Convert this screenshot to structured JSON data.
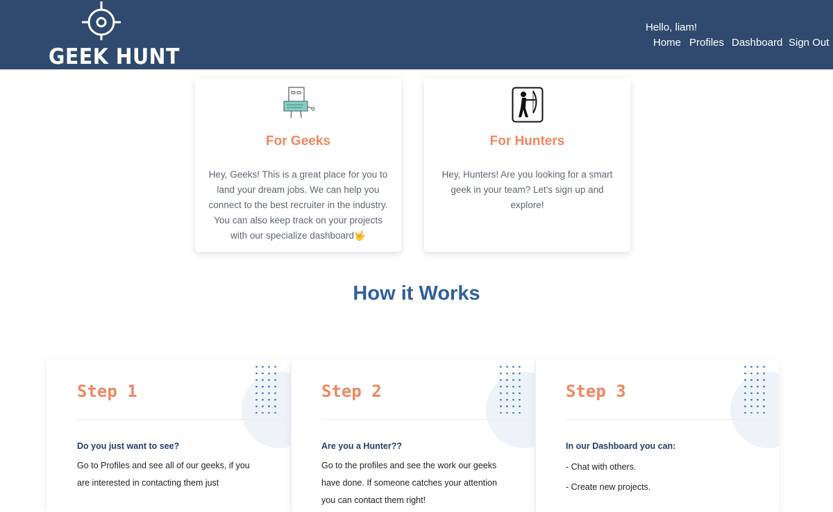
{
  "header": {
    "logo_text": "GEEK HUNT",
    "greeting": "Hello, liam!",
    "nav": [
      "Home",
      "Profiles",
      "Dashboard",
      "Sign Out"
    ]
  },
  "cards": [
    {
      "title": "For Geeks",
      "text": "Hey, Geeks! This is a great place for you to land your dream jobs. We can help you connect to the best recruiter in the industry. You can also keep track on your projects with our specialize dashboard🤟",
      "icon": "geek-robot-icon"
    },
    {
      "title": "For Hunters",
      "text": "Hey, Hunters! Are you looking for a smart geek in your team? Let's sign up and explore!",
      "icon": "archer-icon"
    }
  ],
  "how_it_works": {
    "title": "How it Works",
    "steps": [
      {
        "title": "Step 1",
        "subtitle": "Do you just want to see?",
        "body": "Go to Profiles and see all of our geeks, if you are interested in contacting them just"
      },
      {
        "title": "Step 2",
        "subtitle": "Are you a Hunter??",
        "body": "Go to the profiles and see the work our geeks have done. If someone catches your attention you can contact them right!"
      },
      {
        "title": "Step 3",
        "subtitle": "In our Dashboard you can:",
        "lines": [
          "- Chat with others.",
          "- Create new projects."
        ]
      }
    ]
  },
  "colors": {
    "header_bg": "#2f4a6e",
    "accent_orange": "#f0875f",
    "title_blue": "#2f5f9e",
    "dots_blue": "#3f74c8"
  }
}
